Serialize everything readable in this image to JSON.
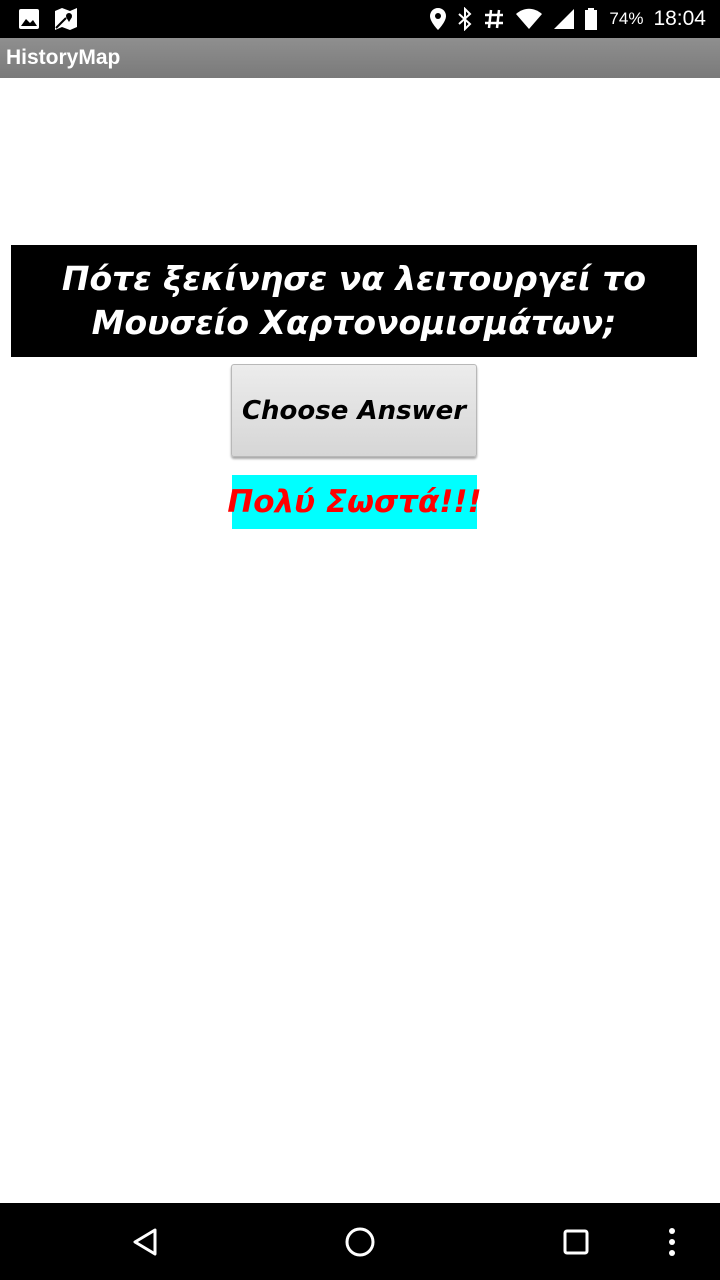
{
  "status_bar": {
    "left_icons": [
      "image-icon",
      "map-icon"
    ],
    "right_icons": [
      "location-icon",
      "bluetooth-icon",
      "hash-icon",
      "wifi-icon",
      "signal-icon"
    ],
    "battery": "74%",
    "time": "18:04"
  },
  "app_bar": {
    "title": "HistoryMap"
  },
  "question": {
    "text": "Πότε ξεκίνησε να λειτουργεί το Μουσείο Χαρτονομισμάτων;"
  },
  "choose_button": {
    "label": "Choose Answer"
  },
  "result": {
    "text": "Πολύ Σωστά!!!",
    "color": "#ff0000",
    "background": "#00ffff"
  },
  "nav_bar": {
    "buttons": [
      "back-icon",
      "home-icon",
      "recents-icon",
      "overflow-menu-icon"
    ]
  }
}
